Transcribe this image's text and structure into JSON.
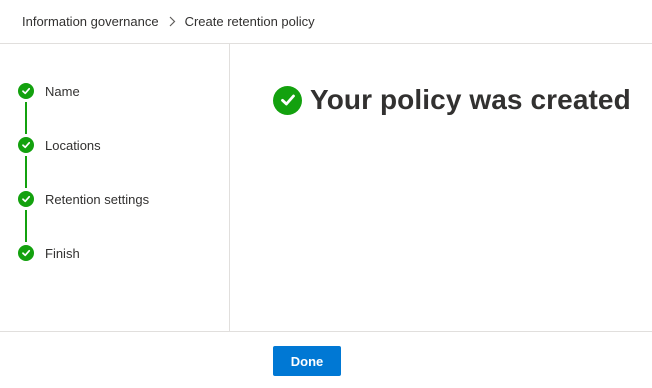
{
  "breadcrumb": {
    "items": [
      {
        "label": "Information governance"
      },
      {
        "label": "Create retention policy"
      }
    ],
    "separator_icon": "chevron-right-icon"
  },
  "wizard": {
    "steps": [
      {
        "label": "Name",
        "status": "completed"
      },
      {
        "label": "Locations",
        "status": "completed"
      },
      {
        "label": "Retention settings",
        "status": "completed"
      },
      {
        "label": "Finish",
        "status": "completed"
      }
    ],
    "step_icon": "checkmark-circle-icon"
  },
  "main": {
    "heading": "Your policy was created",
    "heading_icon": "checkmark-circle-icon"
  },
  "footer": {
    "done_label": "Done"
  },
  "colors": {
    "success": "#13a10e",
    "primary": "#0078d4",
    "text": "#323130",
    "divider": "#e1dfdd"
  }
}
